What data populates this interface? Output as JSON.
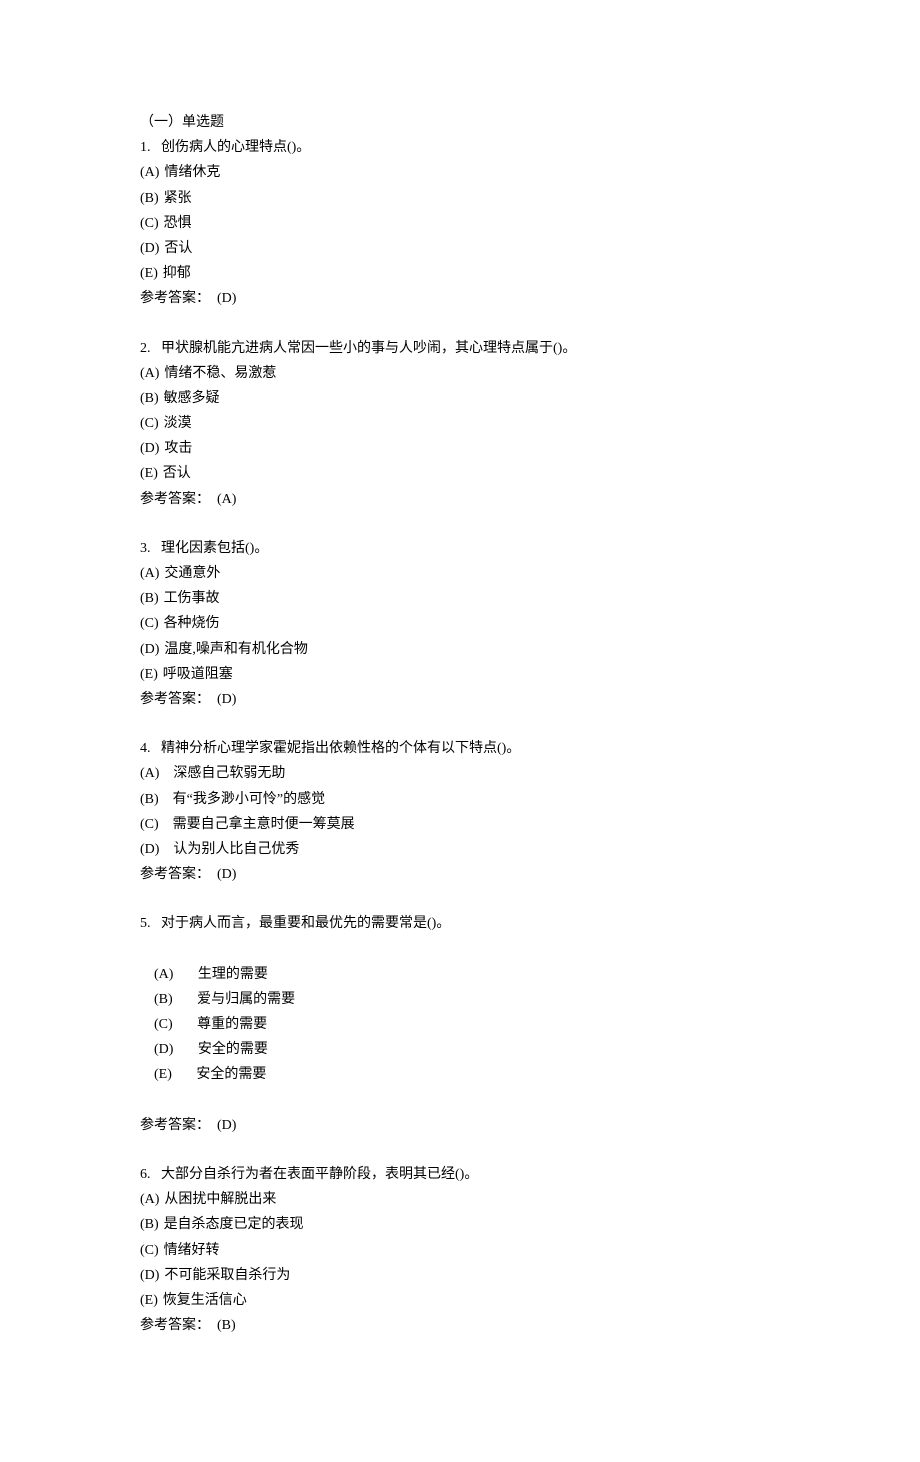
{
  "section_header": "（一）单选题",
  "questions": [
    {
      "number": "1.",
      "stem": "创伤病人的心理特点()。",
      "options": [
        {
          "label": "(A)",
          "text": "情绪休克"
        },
        {
          "label": "(B)",
          "text": "紧张"
        },
        {
          "label": "(C)",
          "text": "恐惧"
        },
        {
          "label": "(D)",
          "text": "否认"
        },
        {
          "label": "(E)",
          "text": "抑郁"
        }
      ],
      "answer_label": "参考答案：",
      "answer_value": "(D)"
    },
    {
      "number": "2.",
      "stem": "甲状腺机能亢进病人常因一些小的事与人吵闹，其心理特点属于()。",
      "options": [
        {
          "label": "(A)",
          "text": "情绪不稳、易激惹"
        },
        {
          "label": "(B)",
          "text": "敏感多疑"
        },
        {
          "label": "(C)",
          "text": "淡漠"
        },
        {
          "label": "(D)",
          "text": "攻击"
        },
        {
          "label": "(E)",
          "text": "否认"
        }
      ],
      "answer_label": "参考答案：",
      "answer_value": "(A)"
    },
    {
      "number": "3.",
      "stem": "理化因素包括()。",
      "options": [
        {
          "label": "(A)",
          "text": "交通意外"
        },
        {
          "label": "(B)",
          "text": "工伤事故"
        },
        {
          "label": "(C)",
          "text": "各种烧伤"
        },
        {
          "label": "(D)",
          "text": "温度,噪声和有机化合物"
        },
        {
          "label": "(E)",
          "text": "呼吸道阻塞"
        }
      ],
      "answer_label": "参考答案：",
      "answer_value": "(D)"
    },
    {
      "number": "4.",
      "stem": "精神分析心理学家霍妮指出依赖性格的个体有以下特点()。",
      "options": [
        {
          "label": "(A)",
          "text": "　深感自己软弱无助"
        },
        {
          "label": "(B)",
          "text": "　有“我多渺小可怜”的感觉"
        },
        {
          "label": "(C)",
          "text": "　需要自己拿主意时便一筹莫展"
        },
        {
          "label": "(D)",
          "text": "　认为别人比自己优秀"
        }
      ],
      "answer_label": "参考答案：",
      "answer_value": "(D)"
    },
    {
      "number": "5.",
      "stem": "对于病人而言，最重要和最优先的需要常是()。",
      "options_inline": [
        {
          "label": "(A)",
          "text": "生理的需要"
        },
        {
          "label": "(B)",
          "text": "爱与归属的需要"
        },
        {
          "label": "(C)",
          "text": "尊重的需要"
        },
        {
          "label": "(D)",
          "text": "安全的需要"
        },
        {
          "label": "(E)",
          "text": "安全的需要"
        }
      ],
      "answer_label": "参考答案：",
      "answer_value": "(D)"
    },
    {
      "number": "6.",
      "stem": "大部分自杀行为者在表面平静阶段，表明其已经()。",
      "options": [
        {
          "label": "(A)",
          "text": "从困扰中解脱出来"
        },
        {
          "label": "(B)",
          "text": "是自杀态度已定的表现"
        },
        {
          "label": "(C)",
          "text": "情绪好转"
        },
        {
          "label": "(D)",
          "text": "不可能采取自杀行为"
        },
        {
          "label": "(E)",
          "text": "恢复生活信心"
        }
      ],
      "answer_label": "参考答案：",
      "answer_value": "(B)"
    }
  ]
}
